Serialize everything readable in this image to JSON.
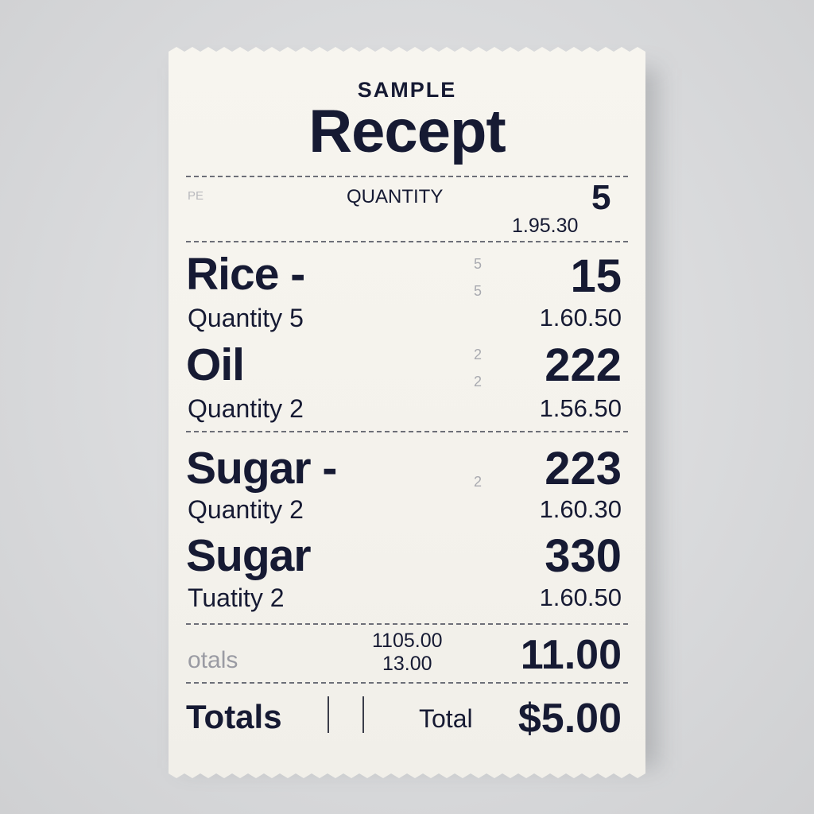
{
  "receipt": {
    "brand_small": "SAMPLE",
    "brand_big": "Recept",
    "header": {
      "left_fragment": "PE",
      "quantity_label": "QUANTITY",
      "number": "5",
      "price": "1.95.30"
    },
    "items": [
      {
        "name": "Rice -",
        "quantity": "Quantity 5",
        "faint": "5",
        "faint2": "5",
        "amount": "15",
        "price": "1.60.50"
      },
      {
        "name": "Oil",
        "quantity": "Quantity 2",
        "faint": "2",
        "faint2": "2",
        "amount": "222",
        "price": "1.56.50"
      },
      {
        "name": "Sugar -",
        "quantity": "Quantity 2",
        "faint": "2",
        "amount": "223",
        "price": "1.60.30"
      },
      {
        "name": "Sugar",
        "quantity": "Tuatity  2",
        "amount": "330",
        "price": "1.60.50"
      }
    ],
    "subtotal": {
      "label": "otals",
      "line1": "1105.00",
      "line2": "13.00",
      "amount": "11.00"
    },
    "total": {
      "totals_label": "Totals",
      "total_label": "Total",
      "amount": "$5.00"
    },
    "colors": {
      "ink": "#161a33",
      "paper": "#f5f3ed",
      "background": "#d9dadc"
    }
  }
}
